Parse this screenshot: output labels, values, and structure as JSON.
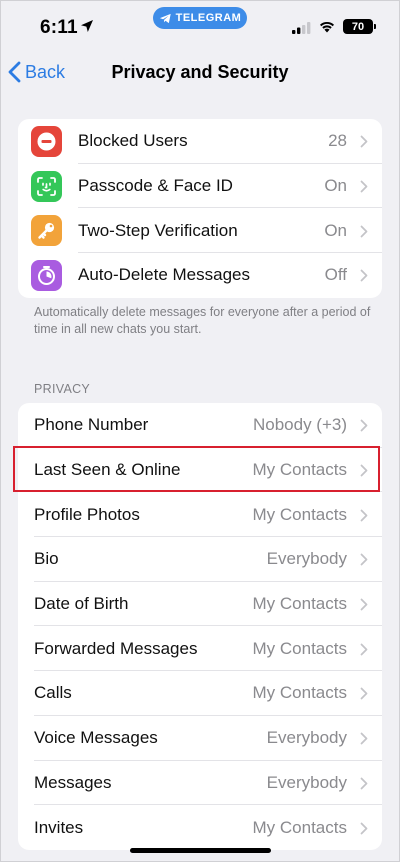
{
  "status_bar": {
    "time": "6:11",
    "app_pill": "TELEGRAM",
    "battery": "70"
  },
  "nav": {
    "back_label": "Back",
    "title": "Privacy and Security"
  },
  "security_items": [
    {
      "label": "Blocked Users",
      "value": "28",
      "icon": "minus-circle-icon",
      "color": "#e5453a"
    },
    {
      "label": "Passcode & Face ID",
      "value": "On",
      "icon": "face-id-icon",
      "color": "#34c759"
    },
    {
      "label": "Two-Step Verification",
      "value": "On",
      "icon": "key-icon",
      "color": "#f2a33a"
    },
    {
      "label": "Auto-Delete Messages",
      "value": "Off",
      "icon": "timer-icon",
      "color": "#a95ce0"
    }
  ],
  "auto_delete_footnote": "Automatically delete messages for everyone after a period of time in all new chats you start.",
  "privacy_section": {
    "header": "PRIVACY",
    "items": [
      {
        "label": "Phone Number",
        "value": "Nobody (+3)"
      },
      {
        "label": "Last Seen & Online",
        "value": "My Contacts"
      },
      {
        "label": "Profile Photos",
        "value": "My Contacts"
      },
      {
        "label": "Bio",
        "value": "Everybody"
      },
      {
        "label": "Date of Birth",
        "value": "My Contacts"
      },
      {
        "label": "Forwarded Messages",
        "value": "My Contacts"
      },
      {
        "label": "Calls",
        "value": "My Contacts"
      },
      {
        "label": "Voice Messages",
        "value": "Everybody"
      },
      {
        "label": "Messages",
        "value": "Everybody"
      },
      {
        "label": "Invites",
        "value": "My Contacts"
      }
    ]
  },
  "colors": {
    "accent": "#2c7ce3",
    "highlight": "#d8202f",
    "background": "#f0f0f4"
  }
}
